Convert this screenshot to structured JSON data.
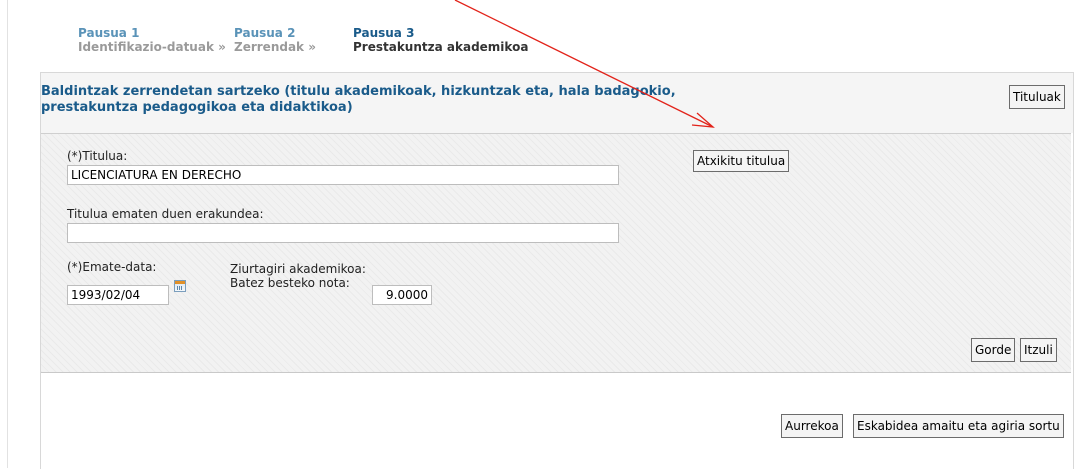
{
  "steps": [
    {
      "number": "Pausua 1",
      "name": "Identifikazio-datuak »",
      "state": "inactive"
    },
    {
      "number": "Pausua 2",
      "name": "Zerrendak »",
      "state": "inactive"
    },
    {
      "number": "Pausua 3",
      "name": "Prestakuntza akademikoa",
      "state": "active"
    }
  ],
  "section": {
    "title": "Baldintzak zerrendetan sartzeko (titulu akademikoak, hizkuntzak eta, hala badagokio, prestakuntza pedagogikoa eta didaktikoa)",
    "tituluak_button": "Tituluak"
  },
  "form": {
    "titulua_label": "(*)Titulua:",
    "titulua_value": "LICENCIATURA EN DERECHO",
    "erakundea_label": "Titulua ematen duen erakundea:",
    "erakundea_value": "",
    "emate_data_label": "(*)Emate-data:",
    "emate_data_value": "1993/02/04",
    "ziurtagiri_label": "Ziurtagiri akademikoa:",
    "batez_besteko_label": "Batez besteko nota:",
    "batez_besteko_value": "9.0000",
    "atxikitu_button": "Atxikitu titulua",
    "gorde_button": "Gorde",
    "itzuli_button": "Itzuli"
  },
  "footer": {
    "aurrekoa_button": "Aurrekoa",
    "amaitu_button": "Eskabidea amaitu eta agiria sortu"
  },
  "colors": {
    "step_inactive": "#5a93b8",
    "step_active": "#1a5b8a",
    "title": "#1a5b8a",
    "arrow": "#e2231a"
  },
  "icons": [
    "calendar-icon",
    "annotation-arrow"
  ]
}
